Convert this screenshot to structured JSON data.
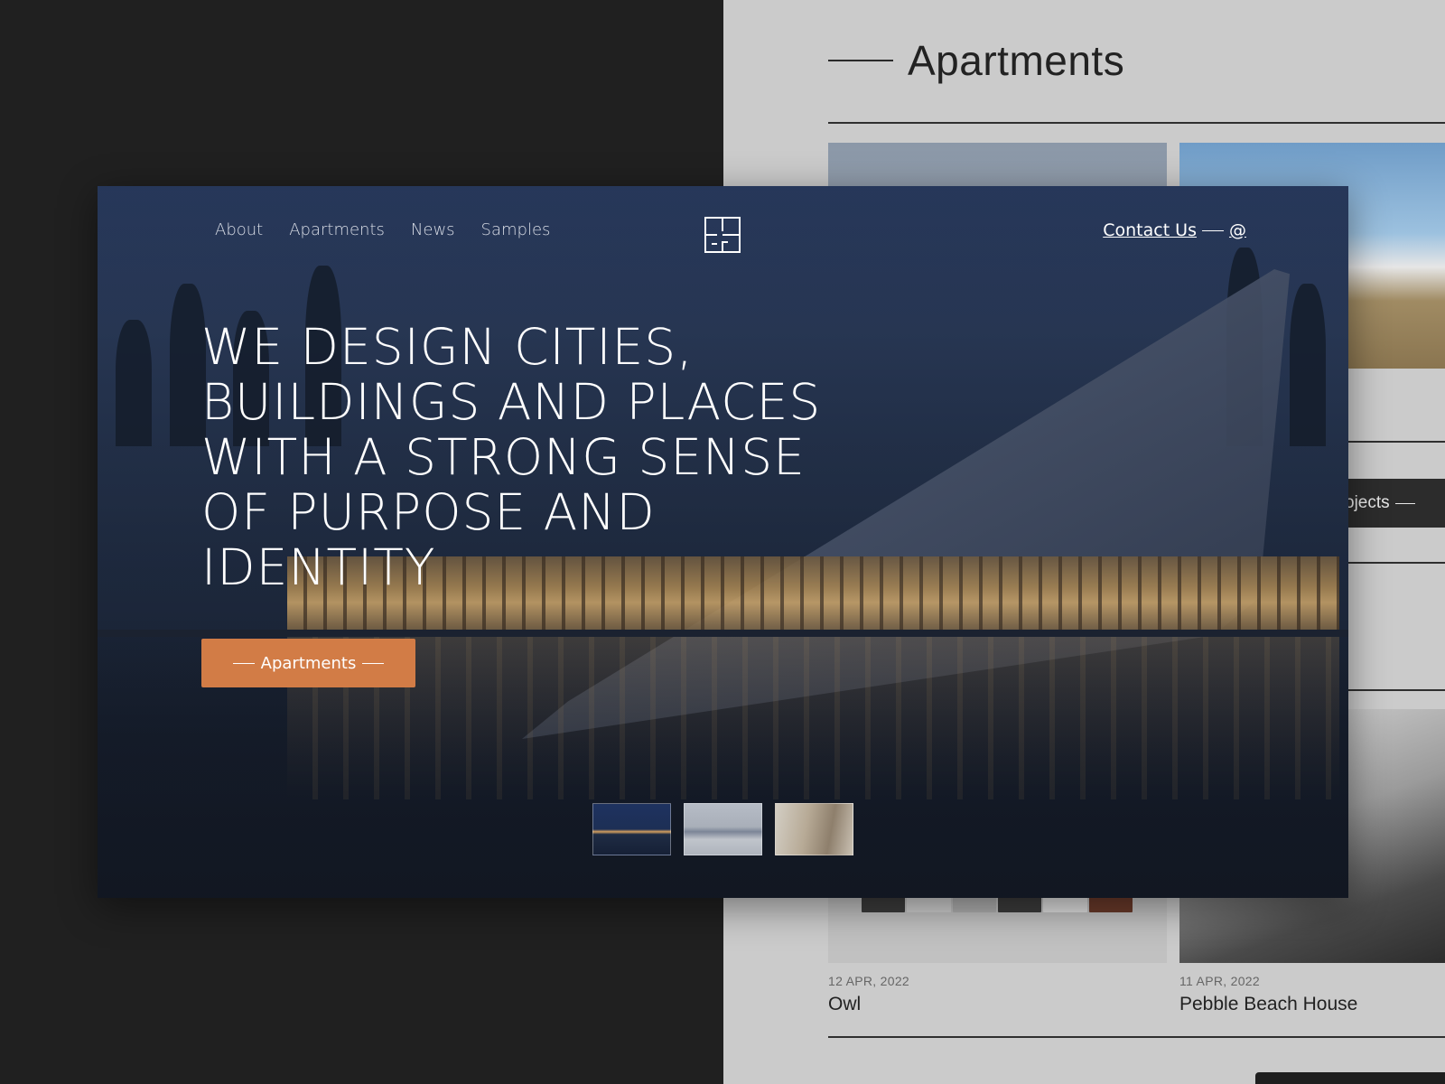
{
  "background_page": {
    "section_title": "Apartments",
    "projects_pill_label": "ojects",
    "cards": [
      {
        "date": "12 APR, 2022",
        "name": "Owl"
      },
      {
        "date": "11 APR, 2022",
        "name": "Pebble Beach House"
      }
    ]
  },
  "hero": {
    "nav": {
      "items": [
        {
          "label": "About"
        },
        {
          "label": "Apartments"
        },
        {
          "label": "News"
        },
        {
          "label": "Samples"
        }
      ]
    },
    "logo_icon": "floorplan-logo-icon",
    "contact": {
      "label": "Contact Us",
      "symbol": "@"
    },
    "headline": "WE DESIGN CITIES, BUILDINGS AND PLACES WITH A STRONG SENSE OF PURPOSE AND IDENTITY",
    "cta_label": "Apartments",
    "accent_color": "#d27c46",
    "slide_count": 3
  }
}
